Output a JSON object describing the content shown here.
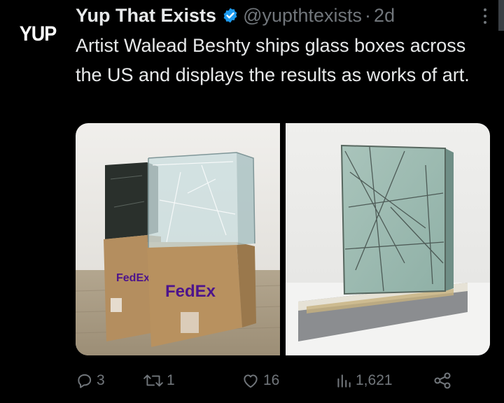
{
  "avatar": {
    "text": "YUP"
  },
  "tweet": {
    "author_name": "Yup That Exists",
    "handle": "@yupthtexists",
    "separator": "·",
    "age": "2d",
    "text": "Artist Walead Beshty ships glass boxes across the US and displays the results as works of art."
  },
  "media": {
    "left_box_label_1": "FedEx",
    "left_box_label_2": "FedEx"
  },
  "actions": {
    "replies": "3",
    "retweets": "1",
    "likes": "16",
    "views": "1,621"
  },
  "colors": {
    "background": "#000000",
    "text": "#e7e9ea",
    "muted": "#71767b",
    "verified": "#1d9bf0",
    "fedex_purple": "#4d148c",
    "fedex_orange": "#ff6600"
  },
  "icons": [
    "verified-badge-icon",
    "more-icon",
    "reply-icon",
    "retweet-icon",
    "like-icon",
    "views-icon",
    "share-icon"
  ]
}
